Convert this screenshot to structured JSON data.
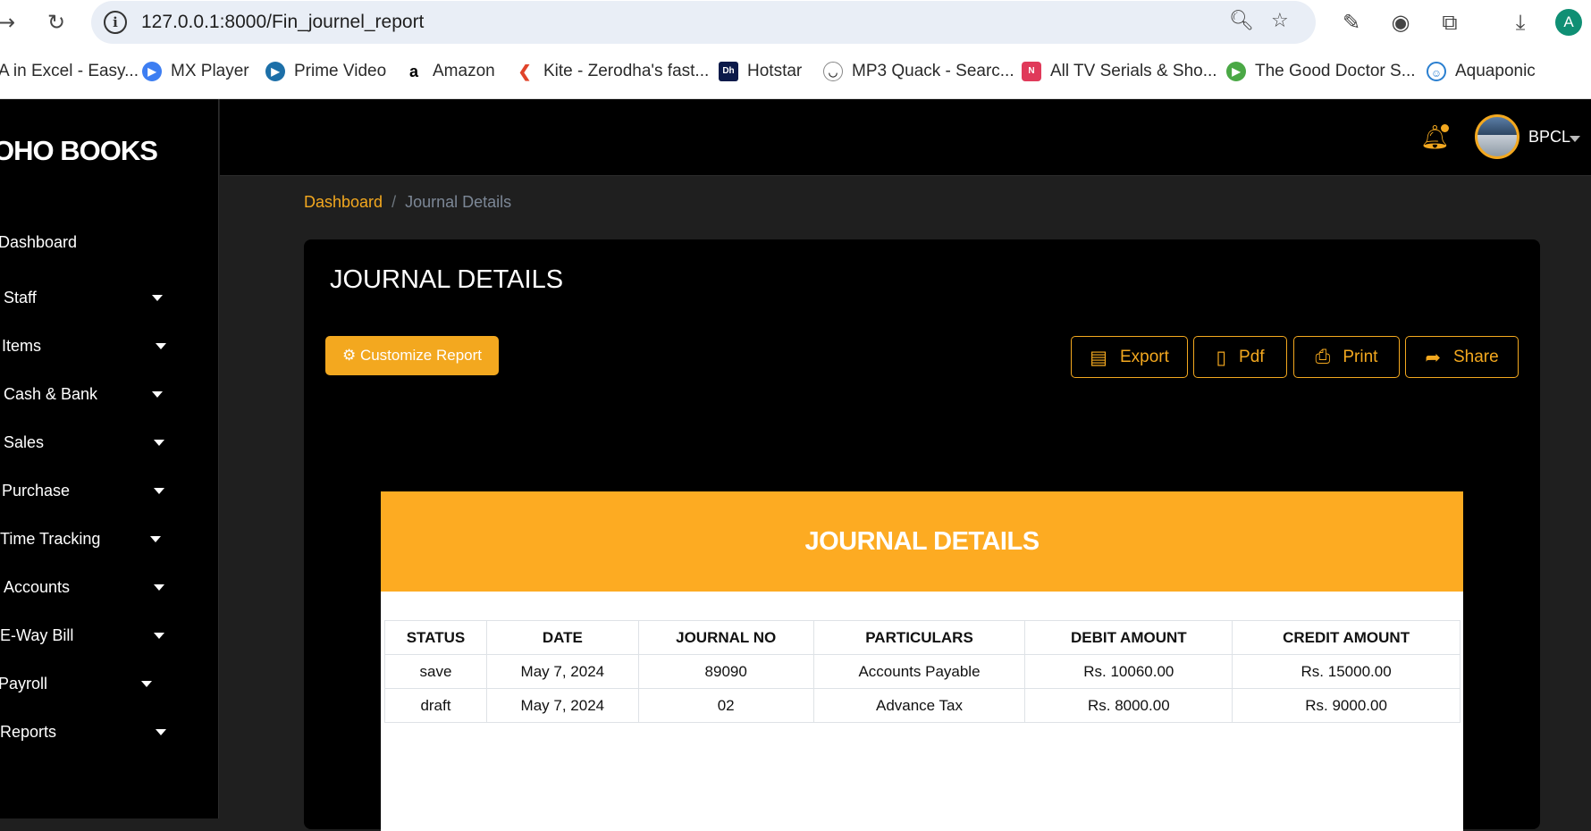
{
  "browser": {
    "url": "127.0.0.1:8000/Fin_journel_report",
    "profile_initial": "A",
    "bookmarks": [
      {
        "label": "A in Excel - Easy..."
      },
      {
        "label": "MX Player"
      },
      {
        "label": "Prime Video"
      },
      {
        "label": "Amazon"
      },
      {
        "label": "Kite - Zerodha's fast..."
      },
      {
        "label": "Hotstar"
      },
      {
        "label": "MP3 Quack - Searc..."
      },
      {
        "label": "All TV Serials & Sho..."
      },
      {
        "label": "The Good Doctor S..."
      },
      {
        "label": "Aquaponic"
      }
    ]
  },
  "sidebar": {
    "brand": "OHO BOOKS",
    "items": [
      {
        "label": "Dashboard"
      },
      {
        "label": "Staff"
      },
      {
        "label": "Items"
      },
      {
        "label": "Cash & Bank"
      },
      {
        "label": "Sales"
      },
      {
        "label": "Purchase"
      },
      {
        "label": "Time Tracking"
      },
      {
        "label": "Accounts"
      },
      {
        "label": "E-Way Bill"
      },
      {
        "label": "Payroll"
      },
      {
        "label": "Reports"
      }
    ]
  },
  "topbar": {
    "user_name": "BPCL"
  },
  "breadcrumb": {
    "home": "Dashboard",
    "separator": "/",
    "current": "Journal Details"
  },
  "page": {
    "title": "JOURNAL DETAILS",
    "customize_label": "Customize Report",
    "export_label": "Export",
    "pdf_label": "Pdf",
    "print_label": "Print",
    "share_label": "Share"
  },
  "report": {
    "title": "JOURNAL DETAILS",
    "columns": [
      "STATUS",
      "DATE",
      "JOURNAL NO",
      "PARTICULARS",
      "DEBIT AMOUNT",
      "CREDIT AMOUNT"
    ],
    "rows": [
      [
        "save",
        "May 7, 2024",
        "89090",
        "Accounts Payable",
        "Rs. 10060.00",
        "Rs. 15000.00"
      ],
      [
        "draft",
        "May 7, 2024",
        "02",
        "Advance Tax",
        "Rs. 8000.00",
        "Rs. 9000.00"
      ]
    ]
  },
  "colors": {
    "accent": "#f3a81f",
    "report_header": "#fdab22",
    "sidebar_bg": "#000000",
    "content_bg": "#1f1f1f"
  }
}
